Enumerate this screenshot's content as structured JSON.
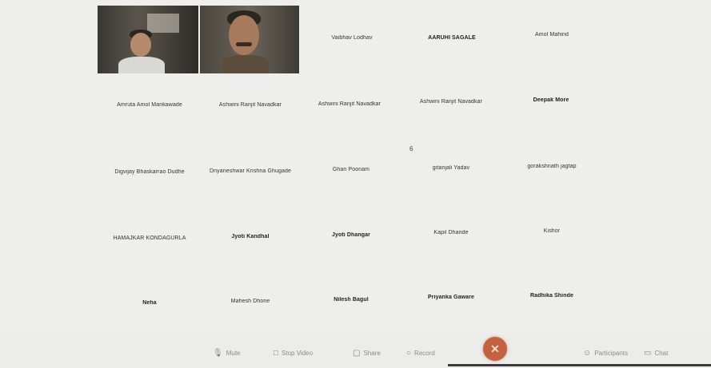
{
  "participants": [
    {
      "name": "",
      "video": true
    },
    {
      "name": "",
      "video": true
    },
    {
      "name": "Vaibhav Lodhav"
    },
    {
      "name": "AARUHI SAGALE"
    },
    {
      "name": "Amol Mahind"
    },
    {
      "name": "Amruta Amol Mankawade"
    },
    {
      "name": "Ashwini Ranjit Navadkar"
    },
    {
      "name": "Ashwini Ranjit Navadkar"
    },
    {
      "name": "Ashwini Ranjit Navadkar"
    },
    {
      "name": "Deepak More"
    },
    {
      "name": "Digvijay Bhaskarrao Dudhe"
    },
    {
      "name": "Dnyaneshwar Krishna Ghugade"
    },
    {
      "name": "Ghan Poonam"
    },
    {
      "name": "gitanjali Yadav"
    },
    {
      "name": "gorakshnath jagtap"
    },
    {
      "name": "HAMAJKAR KONDAGURLA"
    },
    {
      "name": "Jyoti Kandhal"
    },
    {
      "name": "Jyoti Dhangar"
    },
    {
      "name": "Kapil Dhande"
    },
    {
      "name": "Kishor"
    },
    {
      "name": "Neha"
    },
    {
      "name": "Mahesh Dhone"
    },
    {
      "name": "Nilesh Bagul"
    },
    {
      "name": "Priyanka Gaware"
    },
    {
      "name": "Radhika Shinde"
    }
  ],
  "stray_mark": "6",
  "toolbar": {
    "mute": {
      "label": "Mute",
      "icon": "microphone-icon"
    },
    "stop_video": {
      "label": "Stop Video",
      "icon": "camera-icon"
    },
    "share": {
      "label": "Share",
      "icon": "share-screen-icon"
    },
    "record": {
      "label": "Record",
      "icon": "record-icon"
    },
    "end": {
      "label": "✕",
      "icon": "end-call-icon",
      "color": "#c4623e"
    },
    "participants": {
      "label": "Participants",
      "icon": "participants-icon"
    },
    "chat": {
      "label": "Chat",
      "icon": "chat-icon"
    }
  }
}
